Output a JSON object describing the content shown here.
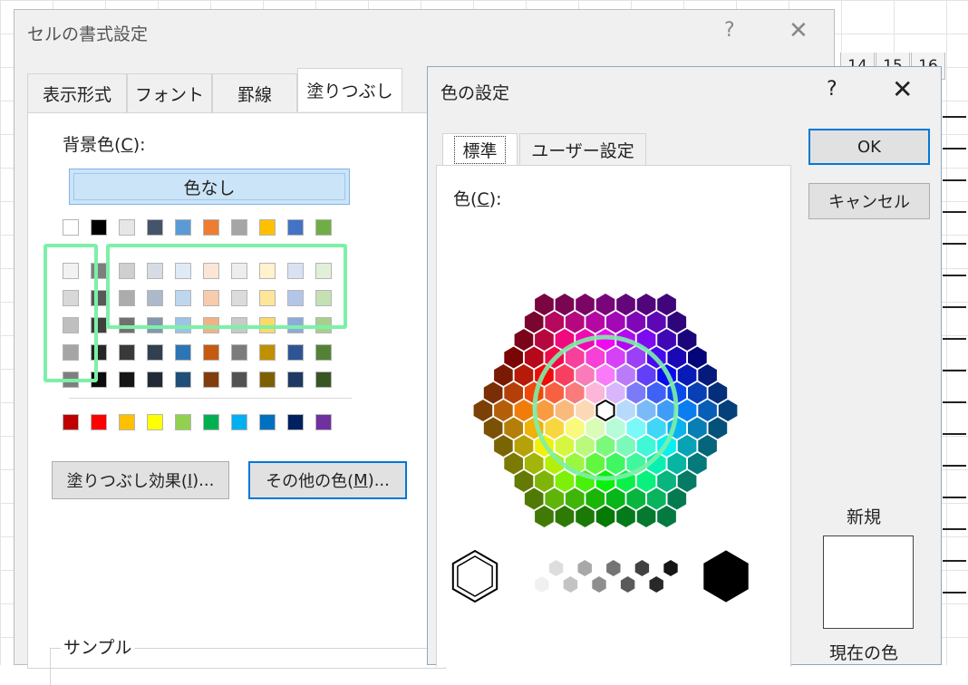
{
  "sheet": {
    "column_headers": [
      "14",
      "15",
      "16"
    ]
  },
  "format_dialog": {
    "title": "セルの書式設定",
    "help": "?",
    "close": "✕",
    "tabs": [
      "表示形式",
      "フォント",
      "罫線",
      "塗りつぶし"
    ],
    "active_tab": "塗りつぶし",
    "background_label": "背景色(C):",
    "no_color_label": "色なし",
    "fill_effects_button": "塗りつぶし効果(I)...",
    "more_colors_button": "その他の色(M)...",
    "sample_label": "サンプル",
    "theme_top_row": [
      "#ffffff",
      "#000000",
      "#e7e6e6",
      "#44546a",
      "#5b9bd5",
      "#ed7d31",
      "#a5a5a5",
      "#ffc000",
      "#4472c4",
      "#70ad47"
    ],
    "theme_shades": [
      [
        "#f2f2f2",
        "#7f7f7f",
        "#d0cece",
        "#d6dce4",
        "#deebf6",
        "#fbe5d5",
        "#ededed",
        "#fff2cc",
        "#d9e2f3",
        "#e2efd9"
      ],
      [
        "#d8d8d8",
        "#595959",
        "#aeabab",
        "#acb9ca",
        "#bdd7ee",
        "#f7cbac",
        "#dbdbdb",
        "#fee599",
        "#b4c6e7",
        "#c5e0b3"
      ],
      [
        "#bfbfbf",
        "#3f3f3f",
        "#757070",
        "#8496b0",
        "#9cc3e5",
        "#f4b183",
        "#c9c9c9",
        "#ffd965",
        "#8eaadb",
        "#a8d08d"
      ],
      [
        "#a5a5a5",
        "#262626",
        "#3a3838",
        "#323f4f",
        "#2e75b5",
        "#c55a11",
        "#7b7b7b",
        "#bf9000",
        "#2f5496",
        "#538135"
      ],
      [
        "#7f7f7f",
        "#0c0c0c",
        "#171616",
        "#222a35",
        "#1e4e79",
        "#833c0b",
        "#525252",
        "#7f6000",
        "#1f3864",
        "#375623"
      ]
    ],
    "standard_colors": [
      "#c00000",
      "#ff0000",
      "#ffc000",
      "#ffff00",
      "#92d050",
      "#00b050",
      "#00b0f0",
      "#0070c0",
      "#002060",
      "#7030a0"
    ]
  },
  "color_dialog": {
    "title": "色の設定",
    "help": "?",
    "close": "✕",
    "tab_standard": "標準",
    "tab_custom": "ユーザー設定",
    "colors_label": "色(C):",
    "ok_button": "OK",
    "cancel_button": "キャンセル",
    "new_label": "新規",
    "current_label": "現在の色",
    "new_color": "#ffffff",
    "grayscale": [
      "#ffffff",
      "#f0f0f0",
      "#dddddd",
      "#c3c3c3",
      "#a8a8a8",
      "#8e8e8e",
      "#747474",
      "#5a5a5a",
      "#414141",
      "#282828",
      "#151515",
      "#000000"
    ]
  }
}
